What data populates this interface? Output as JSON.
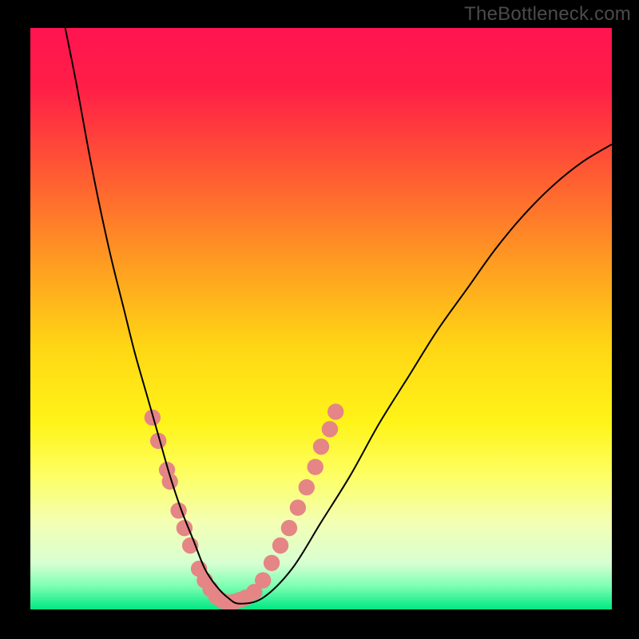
{
  "watermark": "TheBottleneck.com",
  "chart_data": {
    "type": "line",
    "title": "",
    "xlabel": "",
    "ylabel": "",
    "xlim": [
      0,
      100
    ],
    "ylim": [
      0,
      100
    ],
    "gradient_stops": [
      {
        "offset": 0.0,
        "color": "#ff1450"
      },
      {
        "offset": 0.1,
        "color": "#ff1e47"
      },
      {
        "offset": 0.25,
        "color": "#ff5a33"
      },
      {
        "offset": 0.4,
        "color": "#ff9a22"
      },
      {
        "offset": 0.55,
        "color": "#ffd714"
      },
      {
        "offset": 0.68,
        "color": "#fff419"
      },
      {
        "offset": 0.77,
        "color": "#fdff64"
      },
      {
        "offset": 0.85,
        "color": "#f3ffb3"
      },
      {
        "offset": 0.92,
        "color": "#d8ffd1"
      },
      {
        "offset": 0.96,
        "color": "#7dffb2"
      },
      {
        "offset": 1.0,
        "color": "#00e884"
      }
    ],
    "series": [
      {
        "name": "bottleneck-curve",
        "color": "#000000",
        "x": [
          6,
          8,
          10,
          12,
          14,
          16,
          18,
          20,
          22,
          24,
          26,
          28,
          30,
          32,
          34,
          36,
          40,
          45,
          50,
          55,
          60,
          65,
          70,
          75,
          80,
          85,
          90,
          95,
          100
        ],
        "y": [
          100,
          90,
          79,
          69,
          60,
          52,
          44,
          37,
          30,
          23,
          17,
          12,
          7,
          4,
          2,
          1,
          2,
          7,
          15,
          23,
          32,
          40,
          48,
          55,
          62,
          68,
          73,
          77,
          80
        ]
      }
    ],
    "highlight_points": {
      "color": "#e58585",
      "radius_frac": 0.014,
      "points": [
        {
          "x": 21.0,
          "y": 33.0
        },
        {
          "x": 22.0,
          "y": 29.0
        },
        {
          "x": 23.5,
          "y": 24.0
        },
        {
          "x": 24.0,
          "y": 22.0
        },
        {
          "x": 25.5,
          "y": 17.0
        },
        {
          "x": 26.5,
          "y": 14.0
        },
        {
          "x": 27.5,
          "y": 11.0
        },
        {
          "x": 29.0,
          "y": 7.0
        },
        {
          "x": 30.0,
          "y": 5.0
        },
        {
          "x": 31.0,
          "y": 3.5
        },
        {
          "x": 32.0,
          "y": 2.2
        },
        {
          "x": 33.0,
          "y": 1.5
        },
        {
          "x": 34.0,
          "y": 1.2
        },
        {
          "x": 35.0,
          "y": 1.3
        },
        {
          "x": 36.0,
          "y": 1.6
        },
        {
          "x": 37.0,
          "y": 2.0
        },
        {
          "x": 38.5,
          "y": 3.0
        },
        {
          "x": 40.0,
          "y": 5.0
        },
        {
          "x": 41.5,
          "y": 8.0
        },
        {
          "x": 43.0,
          "y": 11.0
        },
        {
          "x": 44.5,
          "y": 14.0
        },
        {
          "x": 46.0,
          "y": 17.5
        },
        {
          "x": 47.5,
          "y": 21.0
        },
        {
          "x": 49.0,
          "y": 24.5
        },
        {
          "x": 50.0,
          "y": 28.0
        },
        {
          "x": 51.5,
          "y": 31.0
        },
        {
          "x": 52.5,
          "y": 34.0
        }
      ]
    }
  }
}
